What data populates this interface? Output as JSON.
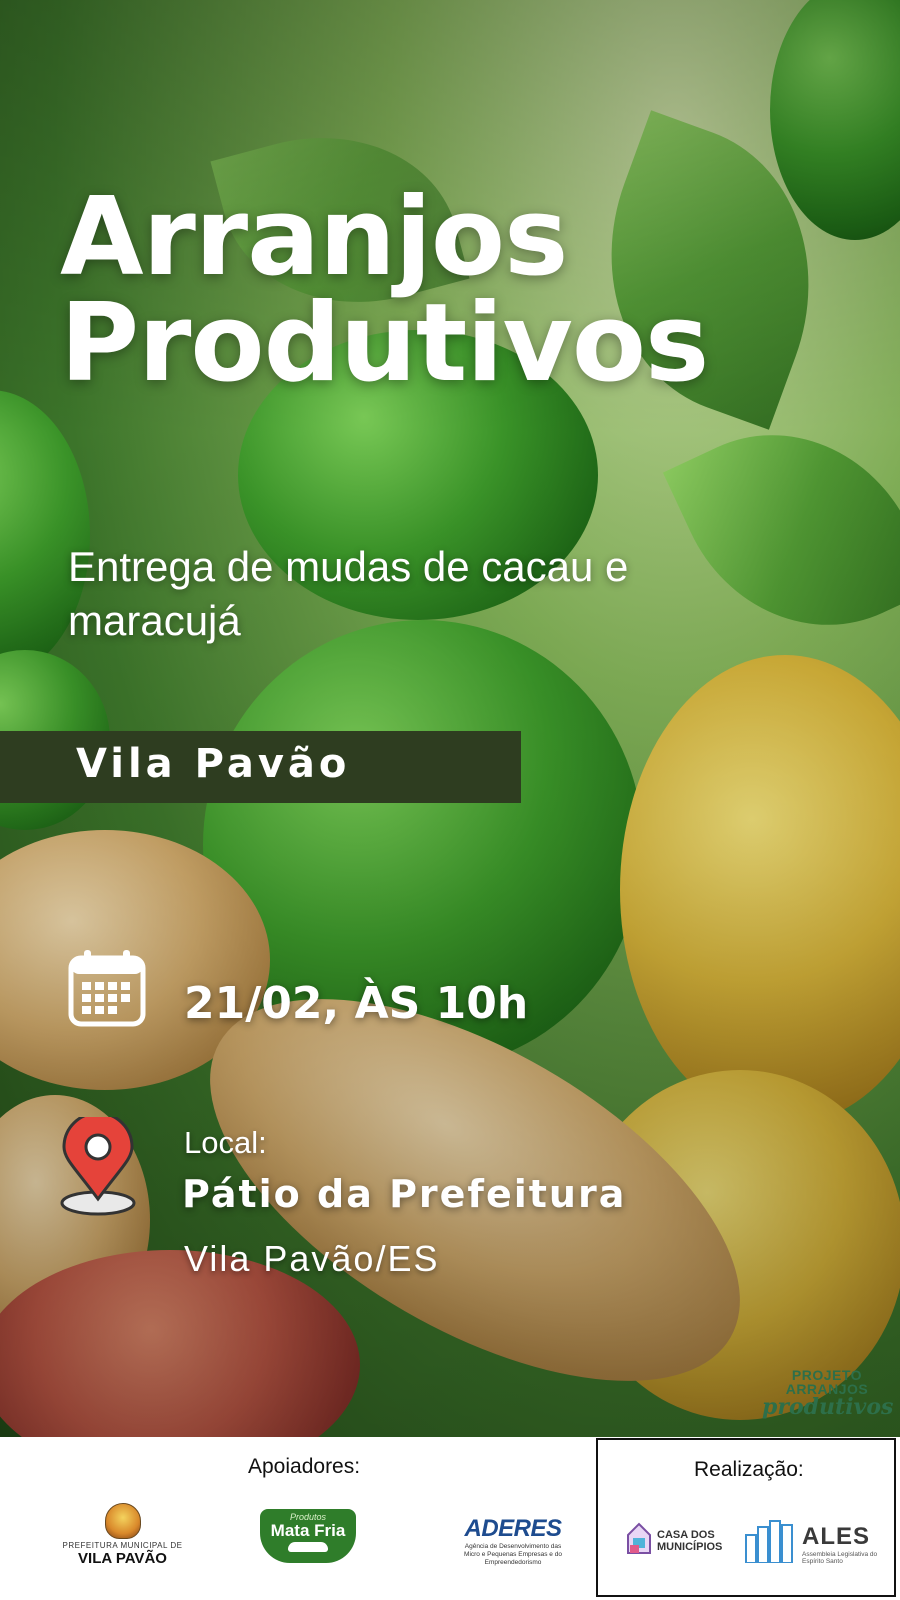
{
  "poster": {
    "title_line1": "Arranjos",
    "title_line2": "Produtivos",
    "subtitle": "Entrega de mudas de cacau e maracujá",
    "location_band": "Vila Pavão",
    "date_time": "21/02, ÀS 10h",
    "location_label": "Local:",
    "location_name": "Pátio da Prefeitura",
    "location_city": "Vila Pavão/ES",
    "project_logo_top": "PROJETO ARRANJOS",
    "project_logo_bottom": "produtivos",
    "icons": [
      "calendar-icon",
      "map-pin-icon"
    ]
  },
  "footer": {
    "supporters_label": "Apoiadores:",
    "realization_label": "Realização:",
    "vila_pavao_small": "PREFEITURA MUNICIPAL DE",
    "vila_pavao_big": "VILA PAVÃO",
    "mata_fria_small": "Produtos",
    "mata_fria_big": "Mata Fria",
    "aderes_big": "ADERES",
    "aderes_sub": "Agência de Desenvolvimento das Micro e Pequenas Empresas e do Empreendedorismo",
    "casa_line1": "CASA DOS",
    "casa_line2": "MUNICÍPIOS",
    "ales_big": "ALES",
    "ales_sub": "Assembleia Legislativa do Espírito Santo"
  },
  "colors": {
    "band": "#2e3d20",
    "pin_red": "#e5433a",
    "aderes_blue": "#1e4c8f",
    "mata_fria_green": "#2f7d2a"
  }
}
